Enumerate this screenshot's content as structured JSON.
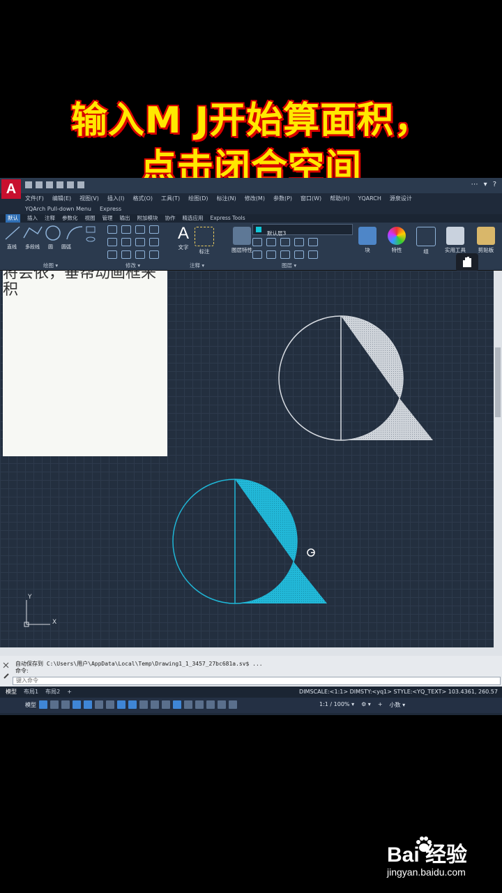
{
  "caption": {
    "line1": "输入M J开始算面积，",
    "line2": "点击闭合空间"
  },
  "app": {
    "logo": "A",
    "title_right": [
      "⋯",
      "▾",
      "?"
    ],
    "menu": [
      "文件(F)",
      "编辑(E)",
      "视图(V)",
      "插入(I)",
      "格式(O)",
      "工具(T)",
      "绘图(D)",
      "标注(N)",
      "修改(M)",
      "参数(P)",
      "窗口(W)",
      "帮助(H)",
      "YQARCH",
      "源泉设计"
    ],
    "menu2": [
      "YQArch Pull-down Menu",
      "Express"
    ],
    "tabs": [
      "默认",
      "插入",
      "注释",
      "参数化",
      "视图",
      "管理",
      "输出",
      "附加模块",
      "协作",
      "精选应用",
      "Express Tools"
    ],
    "active_tab": "默认",
    "ribbon": {
      "draw_labels": [
        "直线",
        "多段线",
        "圆",
        "圆弧"
      ],
      "text_label": "文字",
      "dim_label": "标注",
      "layer_props_label": "图层特性",
      "current_layer": "默认层3",
      "block_label": "块",
      "properties_label": "特性",
      "group_label": "组",
      "utilities_label": "实用工具",
      "clipboard_label": "剪贴板",
      "panels": [
        "绘图 ▾",
        "修改 ▾",
        "注释 ▾",
        "图层 ▾"
      ]
    },
    "overlay_text": [
      "将会依，垂帮动画框来",
      "积"
    ],
    "ucs": {
      "y": "Y",
      "x": "X"
    },
    "command": {
      "history_line": "自动保存到 C:\\Users\\用户\\AppData\\Local\\Temp\\Drawing1_1_3457_27bc681a.sv$ ...",
      "prompt": "命令:",
      "input_placeholder": "键入命令"
    },
    "layout_tabs": [
      "模型",
      "布局1",
      "布局2",
      "+"
    ],
    "status_text": "DIMSCALE:<1:1> DIMSTY:<yq1> STYLE:<YQ_TEXT>   103.4361, 260.57",
    "status_model": "模型",
    "status_right": [
      "1:1 / 100% ▾",
      "⚙ ▾",
      "+",
      "小数 ▾"
    ]
  },
  "colors": {
    "caption_fill": "#ffe800",
    "caption_stroke": "#d80000",
    "hatch_white": "#d9dde3",
    "hatch_cyan": "#1fb6d6"
  },
  "watermark": {
    "brand": "Bai  经验",
    "url": "jingyan.baidu.com"
  }
}
